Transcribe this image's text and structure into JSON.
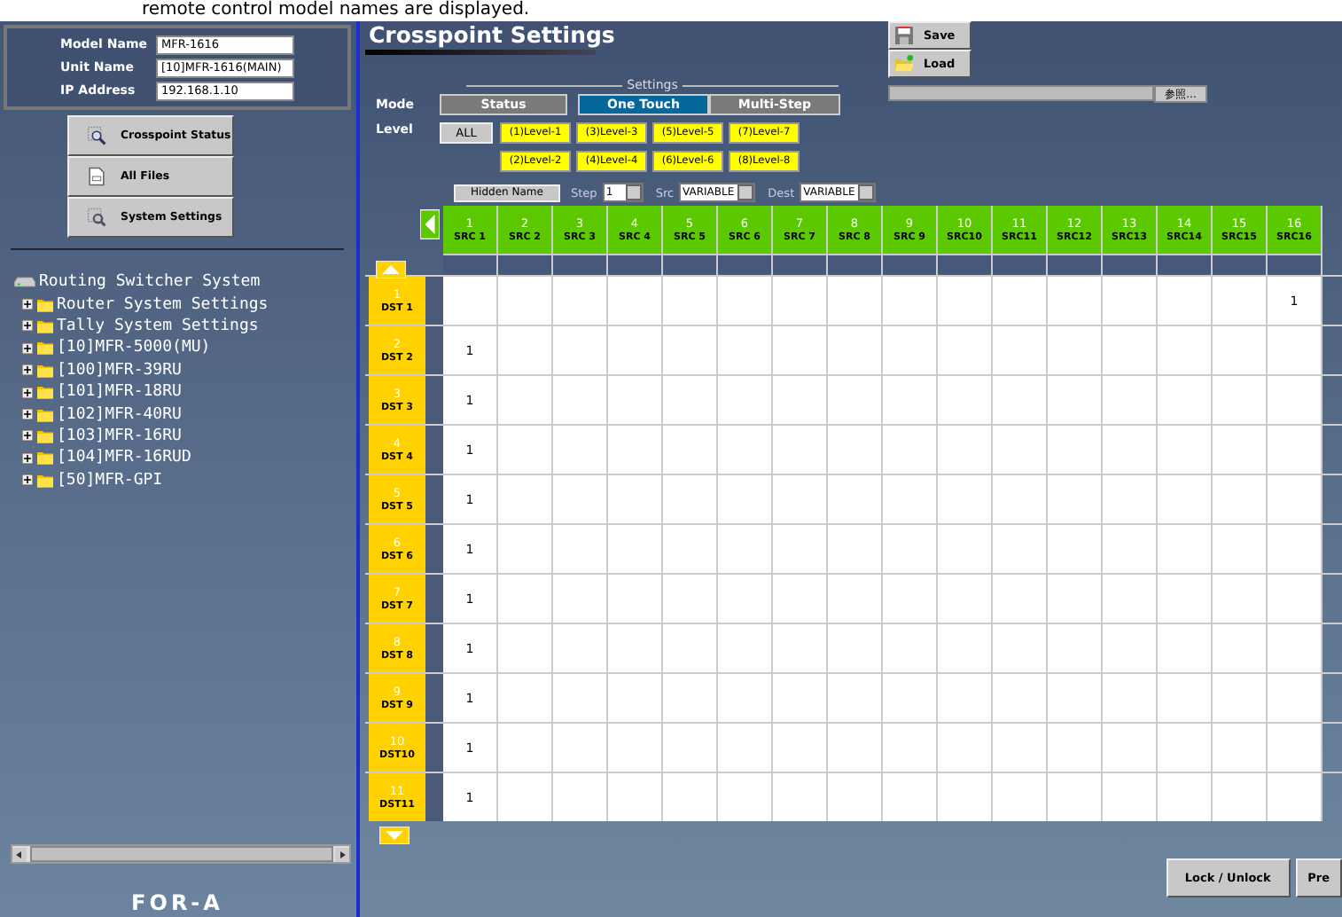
{
  "caption": "remote control model names are displayed.",
  "device": [
    {
      "label": "Model Name",
      "value": "MFR-1616"
    },
    {
      "label": "Unit Name",
      "value": "[10]MFR-1616(MAIN)"
    },
    {
      "label": "IP Address",
      "value": "192.168.1.10"
    }
  ],
  "nav_buttons": [
    {
      "label": "Crosspoint Status",
      "kind": "magnifier"
    },
    {
      "label": "All Files",
      "kind": "file"
    },
    {
      "label": "System Settings",
      "kind": "settings"
    }
  ],
  "tree": {
    "label": "Routing Switcher System",
    "children": [
      {
        "label": "Router System Settings",
        "expanded": false
      },
      {
        "label": "Tally System Settings",
        "expanded": false
      },
      {
        "label": "[10]MFR-5000(MU)",
        "expanded": false
      },
      {
        "label": "[100]MFR-39RU",
        "expanded": false
      },
      {
        "label": "[101]MFR-18RU",
        "expanded": false
      },
      {
        "label": "[102]MFR-40RU",
        "expanded": false
      },
      {
        "label": "[103]MFR-16RU",
        "expanded": false
      },
      {
        "label": "[104]MFR-16RUD",
        "expanded": false
      },
      {
        "label": "[50]MFR-GPI",
        "expanded": false
      }
    ]
  },
  "logo": "FOR-A",
  "title": "Crosspoint Settings",
  "file_buttons": [
    {
      "label": "Save",
      "kind": "save"
    },
    {
      "label": "Load",
      "kind": "load"
    }
  ],
  "file_browse": {
    "button": "参照..."
  },
  "settings_legend": "Settings",
  "mode": {
    "label": "Mode",
    "options": [
      {
        "label": "Status",
        "selected": false
      },
      {
        "label": "One Touch",
        "selected": true
      },
      {
        "label": "Multi-Step",
        "selected": false
      }
    ]
  },
  "level": {
    "label": "Level",
    "all": {
      "label": "ALL",
      "selected": false
    },
    "levels": [
      {
        "label": "(1)Level-1",
        "selected": true
      },
      {
        "label": "(3)Level-3",
        "selected": true
      },
      {
        "label": "(5)Level-5",
        "selected": true
      },
      {
        "label": "(7)Level-7",
        "selected": true
      },
      {
        "label": "(2)Level-2",
        "selected": true
      },
      {
        "label": "(4)Level-4",
        "selected": true
      },
      {
        "label": "(6)Level-6",
        "selected": true
      },
      {
        "label": "(8)Level-8",
        "selected": true
      }
    ]
  },
  "hidden_name": "Hidden Name",
  "step": {
    "label": "Step",
    "value": "1"
  },
  "src": {
    "label": "Src",
    "value": "VARIABLE"
  },
  "dest": {
    "label": "Dest",
    "value": "VARIABLE"
  },
  "columns": [
    {
      "number": "1",
      "name": "SRC 1"
    },
    {
      "number": "2",
      "name": "SRC 2"
    },
    {
      "number": "3",
      "name": "SRC 3"
    },
    {
      "number": "4",
      "name": "SRC 4"
    },
    {
      "number": "5",
      "name": "SRC 5"
    },
    {
      "number": "6",
      "name": "SRC 6"
    },
    {
      "number": "7",
      "name": "SRC 7"
    },
    {
      "number": "8",
      "name": "SRC 8"
    },
    {
      "number": "9",
      "name": "SRC 9"
    },
    {
      "number": "10",
      "name": "SRC10"
    },
    {
      "number": "11",
      "name": "SRC11"
    },
    {
      "number": "12",
      "name": "SRC12"
    },
    {
      "number": "13",
      "name": "SRC13"
    },
    {
      "number": "14",
      "name": "SRC14"
    },
    {
      "number": "15",
      "name": "SRC15"
    },
    {
      "number": "16",
      "name": "SRC16"
    }
  ],
  "rows": [
    {
      "number": "1",
      "name": "DST 1",
      "cells": [
        null,
        null,
        null,
        null,
        null,
        null,
        null,
        null,
        null,
        null,
        null,
        null,
        null,
        null,
        null,
        "1"
      ]
    },
    {
      "number": "2",
      "name": "DST 2",
      "cells": [
        "1",
        null,
        null,
        null,
        null,
        null,
        null,
        null,
        null,
        null,
        null,
        null,
        null,
        null,
        null,
        null
      ]
    },
    {
      "number": "3",
      "name": "DST 3",
      "cells": [
        "1",
        null,
        null,
        null,
        null,
        null,
        null,
        null,
        null,
        null,
        null,
        null,
        null,
        null,
        null,
        null
      ]
    },
    {
      "number": "4",
      "name": "DST 4",
      "cells": [
        "1",
        null,
        null,
        null,
        null,
        null,
        null,
        null,
        null,
        null,
        null,
        null,
        null,
        null,
        null,
        null
      ]
    },
    {
      "number": "5",
      "name": "DST 5",
      "cells": [
        "1",
        null,
        null,
        null,
        null,
        null,
        null,
        null,
        null,
        null,
        null,
        null,
        null,
        null,
        null,
        null
      ]
    },
    {
      "number": "6",
      "name": "DST 6",
      "cells": [
        "1",
        null,
        null,
        null,
        null,
        null,
        null,
        null,
        null,
        null,
        null,
        null,
        null,
        null,
        null,
        null
      ]
    },
    {
      "number": "7",
      "name": "DST 7",
      "cells": [
        "1",
        null,
        null,
        null,
        null,
        null,
        null,
        null,
        null,
        null,
        null,
        null,
        null,
        null,
        null,
        null
      ]
    },
    {
      "number": "8",
      "name": "DST 8",
      "cells": [
        "1",
        null,
        null,
        null,
        null,
        null,
        null,
        null,
        null,
        null,
        null,
        null,
        null,
        null,
        null,
        null
      ]
    },
    {
      "number": "9",
      "name": "DST 9",
      "cells": [
        "1",
        null,
        null,
        null,
        null,
        null,
        null,
        null,
        null,
        null,
        null,
        null,
        null,
        null,
        null,
        null
      ]
    },
    {
      "number": "10",
      "name": "DST10",
      "cells": [
        "1",
        null,
        null,
        null,
        null,
        null,
        null,
        null,
        null,
        null,
        null,
        null,
        null,
        null,
        null,
        null
      ]
    },
    {
      "number": "11",
      "name": "DST11",
      "cells": [
        "1",
        null,
        null,
        null,
        null,
        null,
        null,
        null,
        null,
        null,
        null,
        null,
        null,
        null,
        null,
        null
      ]
    }
  ],
  "bottom_buttons": [
    "Lock / Unlock",
    "Pre"
  ]
}
